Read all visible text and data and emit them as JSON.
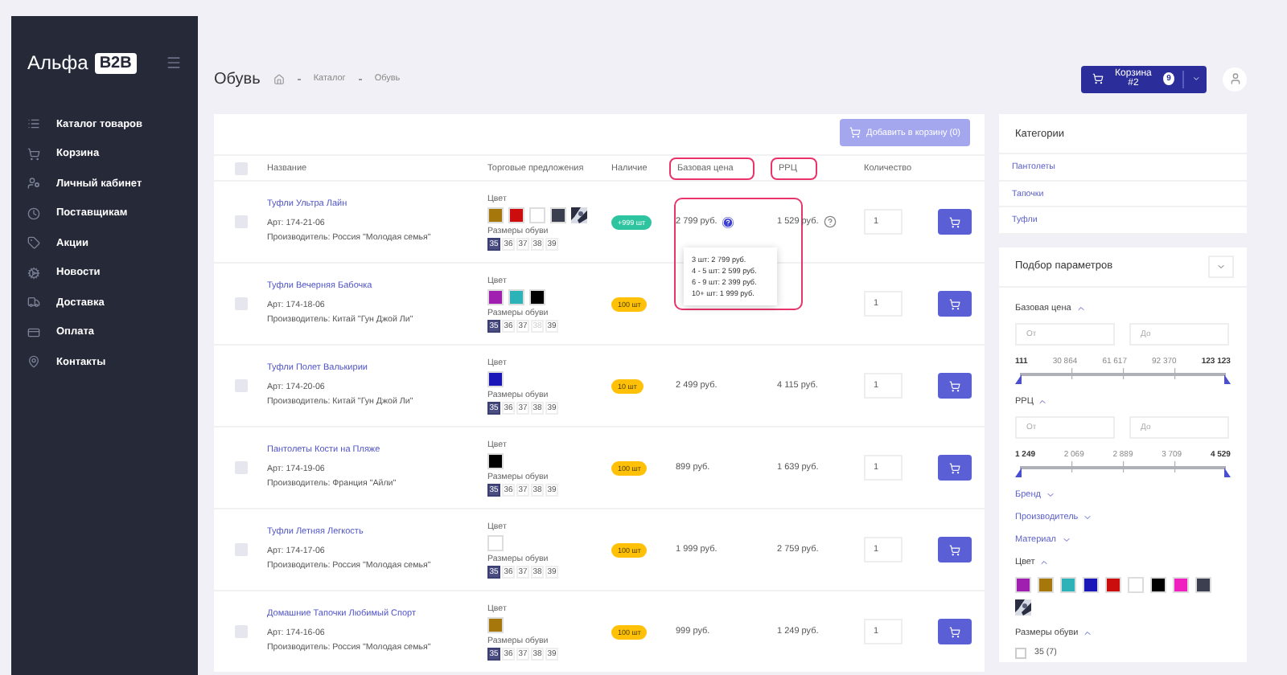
{
  "sidebar": {
    "logo": "Альфа",
    "logo_badge": "B2B",
    "items": [
      {
        "label": "Каталог товаров"
      },
      {
        "label": "Корзина"
      },
      {
        "label": "Личный кабинет"
      },
      {
        "label": "Поставщикам"
      },
      {
        "label": "Акции"
      },
      {
        "label": "Новости"
      },
      {
        "label": "Доставка"
      },
      {
        "label": "Оплата"
      },
      {
        "label": "Контакты"
      }
    ]
  },
  "header": {
    "title": "Обувь",
    "breadcrumbs": [
      "Каталог",
      "Обувь"
    ],
    "cart": {
      "label": "Корзина #2",
      "count": "9"
    }
  },
  "toolbar": {
    "add_button": "Добавить в корзину (0)",
    "disabled": true
  },
  "table": {
    "select_all": {
      "checked": false
    },
    "columns": [
      {
        "label": "Название",
        "highlighted": false
      },
      {
        "label": "Торговые предложения",
        "highlighted": false
      },
      {
        "label": "Наличие",
        "highlighted": false
      },
      {
        "label": "Базовая цена",
        "highlighted": true
      },
      {
        "label": "РРЦ",
        "highlighted": true
      },
      {
        "label": "Количество",
        "highlighted": false
      }
    ],
    "rows": [
      {
        "checked": false,
        "name": "Туфли Ультра Лайн",
        "article": "Арт: 174-21-06",
        "maker": "Производитель: Россия \"Молодая семья\"",
        "color_label": "Цвет",
        "colors": [
          {
            "kind": "solid",
            "color": "#a6780c"
          },
          {
            "kind": "solid",
            "color": "#cc0d0d"
          },
          {
            "kind": "solid",
            "color": "#ffffff"
          },
          {
            "kind": "solid",
            "color": "#3b3f50"
          },
          {
            "kind": "pattern"
          }
        ],
        "sizes_label": "Размеры обуви",
        "sizes": [
          {
            "label": "35",
            "selected": true,
            "disabled": false
          },
          {
            "label": "36",
            "selected": false,
            "disabled": false
          },
          {
            "label": "37",
            "selected": false,
            "disabled": false
          },
          {
            "label": "38",
            "selected": false,
            "disabled": false
          },
          {
            "label": "39",
            "selected": false,
            "disabled": false
          }
        ],
        "stock": {
          "label": "+999 шт",
          "color": "#2ec4a0"
        },
        "price": "2 799 руб.",
        "price_info": true,
        "rrp": "1 529 руб.",
        "rrp_info": true,
        "quantity": "1",
        "highlighted": true,
        "price_tiers": [
          "3 шт: 2 799 руб.",
          "4 - 5 шт: 2 599 руб.",
          "6 - 9 шт: 2 399 руб.",
          "10+ шт: 1 999 руб."
        ]
      },
      {
        "checked": false,
        "name": "Туфли Вечерняя Бабочка",
        "article": "Арт: 174-18-06",
        "maker": "Производитель: Китай \"Гун Джой Ли\"",
        "color_label": "Цвет",
        "colors": [
          {
            "kind": "solid",
            "color": "#a01fb0"
          },
          {
            "kind": "solid",
            "color": "#2bb3b8"
          },
          {
            "kind": "solid",
            "color": "#000000"
          }
        ],
        "sizes_label": "Размеры обуви",
        "sizes": [
          {
            "label": "35",
            "selected": true,
            "disabled": false
          },
          {
            "label": "36",
            "selected": false,
            "disabled": false
          },
          {
            "label": "37",
            "selected": false,
            "disabled": false
          },
          {
            "label": "38",
            "selected": false,
            "disabled": true
          },
          {
            "label": "39",
            "selected": false,
            "disabled": false
          }
        ],
        "stock": {
          "label": "100 шт",
          "color": "#ffc107"
        },
        "price_info": false,
        "rrp_info": false,
        "quantity": "1",
        "highlighted": false
      },
      {
        "checked": false,
        "name": "Туфли Полет Валькирии",
        "article": "Арт: 174-20-06",
        "maker": "Производитель: Китай \"Гун Джой Ли\"",
        "color_label": "Цвет",
        "colors": [
          {
            "kind": "solid",
            "color": "#1a16b8"
          }
        ],
        "sizes_label": "Размеры обуви",
        "sizes": [
          {
            "label": "35",
            "selected": true,
            "disabled": false
          },
          {
            "label": "36",
            "selected": false,
            "disabled": false
          },
          {
            "label": "37",
            "selected": false,
            "disabled": false
          },
          {
            "label": "38",
            "selected": false,
            "disabled": false
          },
          {
            "label": "39",
            "selected": false,
            "disabled": false
          }
        ],
        "stock": {
          "label": "10 шт",
          "color": "#ffc107"
        },
        "price": "2 499 руб.",
        "price_info": false,
        "rrp": "4 115 руб.",
        "rrp_info": false,
        "quantity": "1",
        "highlighted": false
      },
      {
        "checked": false,
        "name": "Пантолеты Кости на Пляже",
        "article": "Арт: 174-19-06",
        "maker": "Производитель: Франция \"Айли\"",
        "color_label": "Цвет",
        "colors": [
          {
            "kind": "solid",
            "color": "#000000"
          }
        ],
        "sizes_label": "Размеры обуви",
        "sizes": [
          {
            "label": "35",
            "selected": true,
            "disabled": false
          },
          {
            "label": "36",
            "selected": false,
            "disabled": false
          },
          {
            "label": "37",
            "selected": false,
            "disabled": false
          },
          {
            "label": "38",
            "selected": false,
            "disabled": false
          },
          {
            "label": "39",
            "selected": false,
            "disabled": false
          }
        ],
        "stock": {
          "label": "100 шт",
          "color": "#ffc107"
        },
        "price": "899 руб.",
        "price_info": false,
        "rrp": "1 639 руб.",
        "rrp_info": false,
        "quantity": "1",
        "highlighted": false
      },
      {
        "checked": false,
        "name": "Туфли Летняя Легкость",
        "article": "Арт: 174-17-06",
        "maker": "Производитель: Россия \"Молодая семья\"",
        "color_label": "Цвет",
        "colors": [
          {
            "kind": "solid",
            "color": "#ffffff"
          }
        ],
        "sizes_label": "Размеры обуви",
        "sizes": [
          {
            "label": "35",
            "selected": true,
            "disabled": false
          },
          {
            "label": "36",
            "selected": false,
            "disabled": false
          },
          {
            "label": "37",
            "selected": false,
            "disabled": false
          },
          {
            "label": "38",
            "selected": false,
            "disabled": false
          },
          {
            "label": "39",
            "selected": false,
            "disabled": false
          }
        ],
        "stock": {
          "label": "100 шт",
          "color": "#ffc107"
        },
        "price": "1 999 руб.",
        "price_info": false,
        "rrp": "2 759 руб.",
        "rrp_info": false,
        "quantity": "1",
        "highlighted": false
      },
      {
        "checked": false,
        "name": "Домашние Тапочки Любимый Спорт",
        "article": "Арт: 174-16-06",
        "maker": "Производитель: Россия \"Молодая семья\"",
        "color_label": "Цвет",
        "colors": [
          {
            "kind": "solid",
            "color": "#a6780c"
          }
        ],
        "sizes_label": "Размеры обуви",
        "sizes": [
          {
            "label": "35",
            "selected": true,
            "disabled": false
          },
          {
            "label": "36",
            "selected": false,
            "disabled": false
          },
          {
            "label": "37",
            "selected": false,
            "disabled": false
          },
          {
            "label": "38",
            "selected": false,
            "disabled": false
          },
          {
            "label": "39",
            "selected": false,
            "disabled": false
          }
        ],
        "stock": {
          "label": "100 шт",
          "color": "#ffc107"
        },
        "price": "999 руб.",
        "price_info": false,
        "rrp": "1 249 руб.",
        "rrp_info": false,
        "quantity": "1",
        "highlighted": false
      }
    ]
  },
  "categories": {
    "title": "Категории",
    "items": [
      "Пантолеты",
      "Тапочки",
      "Туфли"
    ]
  },
  "filters": {
    "title": "Подбор параметров",
    "groups": [
      {
        "kind": "range",
        "label": "Базовая цена",
        "expanded": true,
        "level": 1,
        "from_placeholder": "От",
        "to_placeholder": "До",
        "scale": [
          "111",
          "30 864",
          "61 617",
          "92 370",
          "123 123"
        ]
      },
      {
        "kind": "range",
        "label": "РРЦ",
        "expanded": true,
        "level": 1,
        "from_placeholder": "От",
        "to_placeholder": "До",
        "scale": [
          "1 249",
          "2 069",
          "2 889",
          "3 709",
          "4 529"
        ]
      },
      {
        "kind": "list",
        "label": "Бренд",
        "expanded": false
      },
      {
        "kind": "list",
        "label": "Производитель",
        "expanded": false
      },
      {
        "kind": "list",
        "label": "Материал",
        "expanded": false
      },
      {
        "kind": "colors",
        "label": "Цвет",
        "expanded": true,
        "colors": [
          {
            "kind": "solid",
            "color": "#a01fb0"
          },
          {
            "kind": "solid",
            "color": "#a6780c"
          },
          {
            "kind": "solid",
            "color": "#2bb3b8"
          },
          {
            "kind": "solid",
            "color": "#1a16b8"
          },
          {
            "kind": "solid",
            "color": "#cc0d0d"
          },
          {
            "kind": "solid",
            "color": "#ffffff"
          },
          {
            "kind": "solid",
            "color": "#000000"
          },
          {
            "kind": "solid",
            "color": "#f020c0"
          },
          {
            "kind": "solid",
            "color": "#3b3f50"
          },
          {
            "kind": "pattern"
          }
        ]
      },
      {
        "kind": "checkboxes",
        "label": "Размеры обуви",
        "expanded": true,
        "options": [
          {
            "label": "35 (7)",
            "checked": false
          }
        ]
      }
    ]
  }
}
